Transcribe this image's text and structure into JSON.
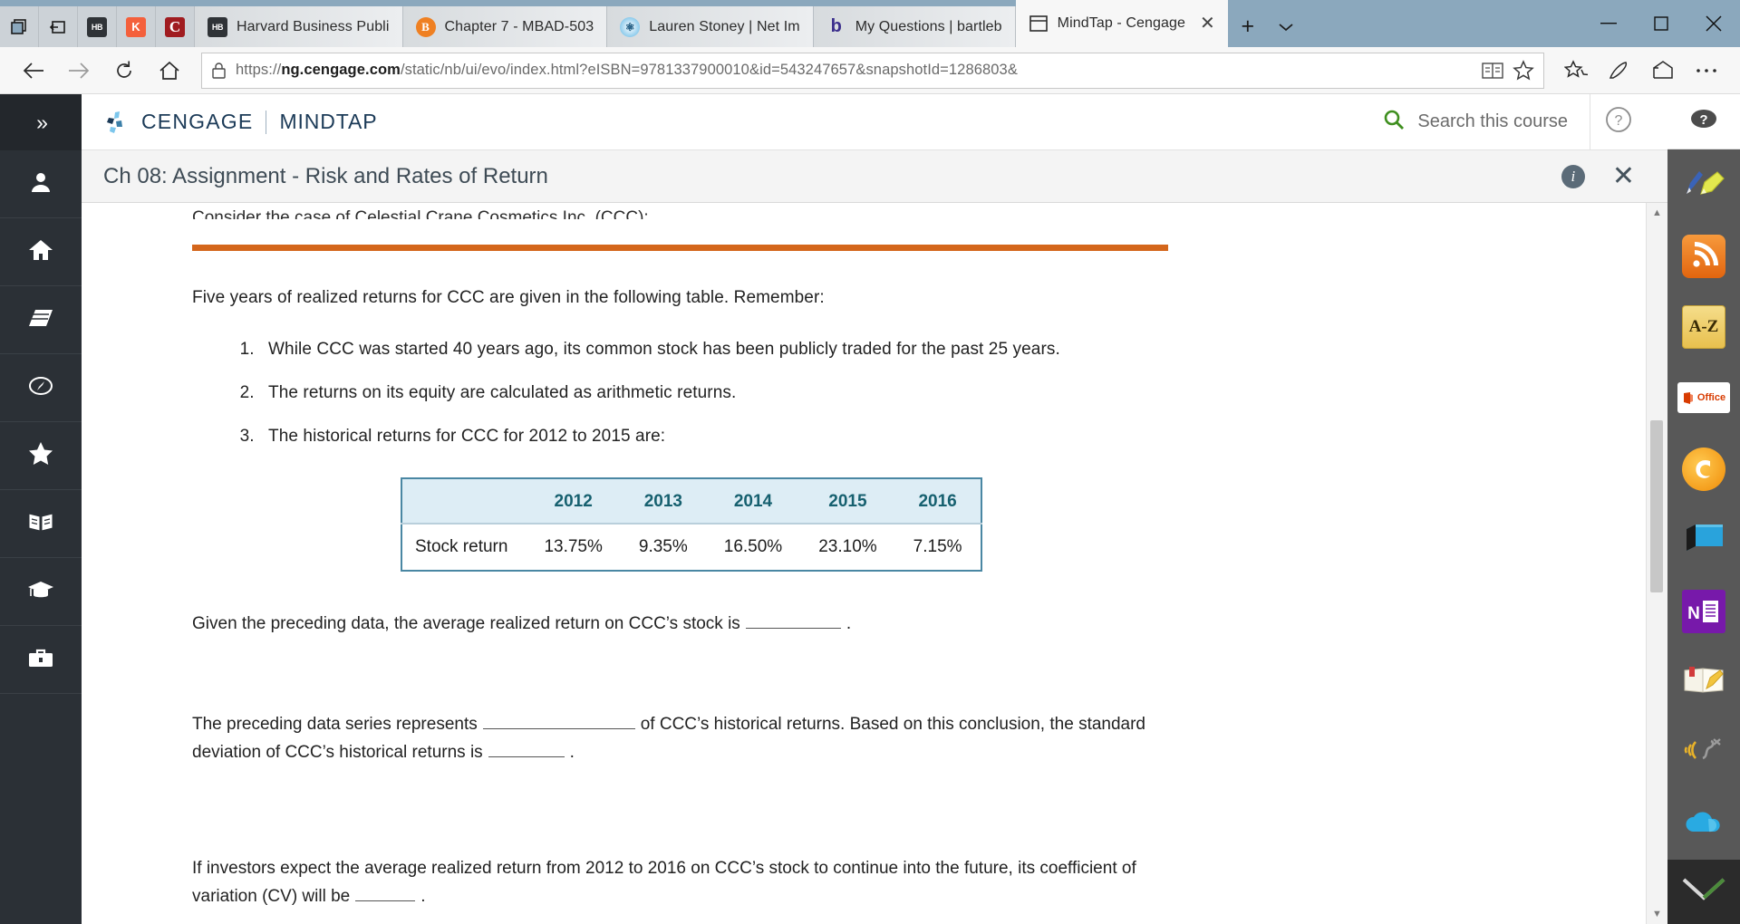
{
  "browser": {
    "tabs": [
      {
        "title": "",
        "icon": "window-restore-icon",
        "icon_only": true,
        "active": false
      },
      {
        "title": "",
        "icon": "collapse-tabs-icon",
        "icon_only": true,
        "active": false
      },
      {
        "title": "",
        "icon": "hb-favicon",
        "icon_only": true,
        "active": false
      },
      {
        "title": "",
        "icon": "k-favicon",
        "icon_only": true,
        "active": false
      },
      {
        "title": "",
        "icon": "c-favicon",
        "icon_only": true,
        "active": false
      },
      {
        "title": "Harvard Business Publi",
        "icon": "hb-favicon",
        "icon_only": false,
        "active": false
      },
      {
        "title": "Chapter 7 - MBAD-503",
        "icon": "b-orange-favicon",
        "icon_only": false,
        "active": false
      },
      {
        "title": "Lauren Stoney | Net Im",
        "icon": "net-favicon",
        "icon_only": false,
        "active": false
      },
      {
        "title": "My Questions | bartleb",
        "icon": "bartleby-favicon",
        "icon_only": false,
        "active": false
      },
      {
        "title": "MindTap - Cengage",
        "icon": "mindtap-favicon",
        "icon_only": false,
        "active": true
      }
    ],
    "new_tab_label": "+",
    "tab_list_caret": "⌄",
    "window_controls": {
      "minimize": "─",
      "maximize": "□",
      "close": "✕"
    },
    "nav": {
      "back": "←",
      "forward": "→",
      "refresh": "⟳",
      "home": "⌂",
      "url_prefix": "https://",
      "url_domain": "ng.cengage.com",
      "url_path": "/static/nb/ui/evo/index.html?eISBN=9781337900010&id=543247657&snapshotId=1286803&",
      "url_full": "https://ng.cengage.com/static/nb/ui/evo/index.html?eISBN=9781337900010&id=543247657&snapshotId=1286803&",
      "lock_icon": "padlock-icon",
      "reading_view_icon": "reading-view-icon",
      "favorite_icon": "star-icon",
      "hub_icon": "favorites-hub-icon",
      "notes_icon": "web-note-icon",
      "share_icon": "share-icon",
      "more_icon": "more-actions-icon"
    }
  },
  "rail": {
    "expand_label": "»",
    "items": [
      {
        "name": "profile",
        "icon": "person-icon"
      },
      {
        "name": "home",
        "icon": "home-icon"
      },
      {
        "name": "course",
        "icon": "book-stack-icon"
      },
      {
        "name": "explore",
        "icon": "compass-icon"
      },
      {
        "name": "favorites",
        "icon": "star-icon"
      },
      {
        "name": "reader",
        "icon": "open-book-icon"
      },
      {
        "name": "grades",
        "icon": "graduation-cap-icon"
      },
      {
        "name": "career",
        "icon": "briefcase-icon"
      }
    ]
  },
  "header": {
    "brand": "CENGAGE",
    "product": "MINDTAP",
    "search_label": "Search this course",
    "search_icon": "search-icon",
    "search_icon_color": "#3f8f1f",
    "help_icon": "help-icon"
  },
  "assignment": {
    "title": "Ch 08: Assignment - Risk and Rates of Return",
    "info_label": "i",
    "close_label": "✕"
  },
  "content": {
    "clipped_line": "Consider the case of Celestial Crane Cosmetics Inc. (CCC):",
    "rule_color": "#d4661b",
    "intro": "Five years of realized returns for CCC are given in the following table. Remember:",
    "steps": [
      "While CCC was started 40 years ago, its common stock has been publicly traded for the past 25 years.",
      "The returns on its equity are calculated as arithmetic returns.",
      "The historical returns for CCC for 2012 to 2015 are:"
    ],
    "table": {
      "corner": "",
      "columns": [
        "2012",
        "2013",
        "2014",
        "2015",
        "2016"
      ],
      "row_label": "Stock return",
      "values": [
        "13.75%",
        "9.35%",
        "16.50%",
        "23.10%",
        "7.15%"
      ]
    },
    "questions": [
      {
        "id": "q1",
        "parts": [
          {
            "type": "text",
            "value": "Given the preceding data, the average realized return on CCC’s stock is"
          },
          {
            "type": "blank",
            "size": "w-lg"
          },
          {
            "type": "text",
            "value": "."
          }
        ]
      },
      {
        "id": "q2",
        "parts": [
          {
            "type": "text",
            "value": "The preceding data series represents"
          },
          {
            "type": "blank",
            "size": "w-xl"
          },
          {
            "type": "text",
            "value": "of CCC’s historical returns. Based on this conclusion, the standard deviation of CCC’s historical returns is"
          },
          {
            "type": "blank",
            "size": "w-md"
          },
          {
            "type": "text",
            "value": "."
          }
        ]
      },
      {
        "id": "q3",
        "parts": [
          {
            "type": "text",
            "value": "If investors expect the average realized return from 2012 to 2016 on CCC’s stock to continue into the future, its coefficient of variation (CV) will be"
          },
          {
            "type": "blank",
            "size": "w-sm"
          },
          {
            "type": "text",
            "value": "."
          }
        ]
      }
    ],
    "q1_text_a": "Given the preceding data, the average realized return on CCC’s stock is",
    "q1_text_b": ".",
    "q2_text_a": "The preceding data series represents",
    "q2_text_b": "of CCC’s historical returns. Based on this conclusion, the",
    "q2_text_c": "standard deviation of CCC’s historical returns is",
    "q2_text_d": ".",
    "q3_text_a": "If investors expect the average realized return from 2012 to 2016 on CCC’s stock to continue into the future, its",
    "q3_text_b": "coefficient of variation (CV) will be",
    "q3_text_c": "."
  },
  "scrollbar": {
    "up_arrow": "▲",
    "down_arrow": "▼"
  },
  "dock": {
    "help_icon": "help-icon",
    "items": [
      {
        "name": "pen-highlighter-icon"
      },
      {
        "name": "rss-feed-icon"
      },
      {
        "name": "dictionary-az-icon",
        "label": "A-Z"
      },
      {
        "name": "ms-office-icon",
        "label": "Office"
      },
      {
        "name": "browser-6-icon"
      },
      {
        "name": "blue-book-icon"
      },
      {
        "name": "onenote-icon",
        "label": "N"
      },
      {
        "name": "notebook-pencil-icon"
      },
      {
        "name": "audio-read-icon"
      },
      {
        "name": "cloud-icon"
      }
    ],
    "bottom_icon": "chevron-collapse-icon"
  }
}
